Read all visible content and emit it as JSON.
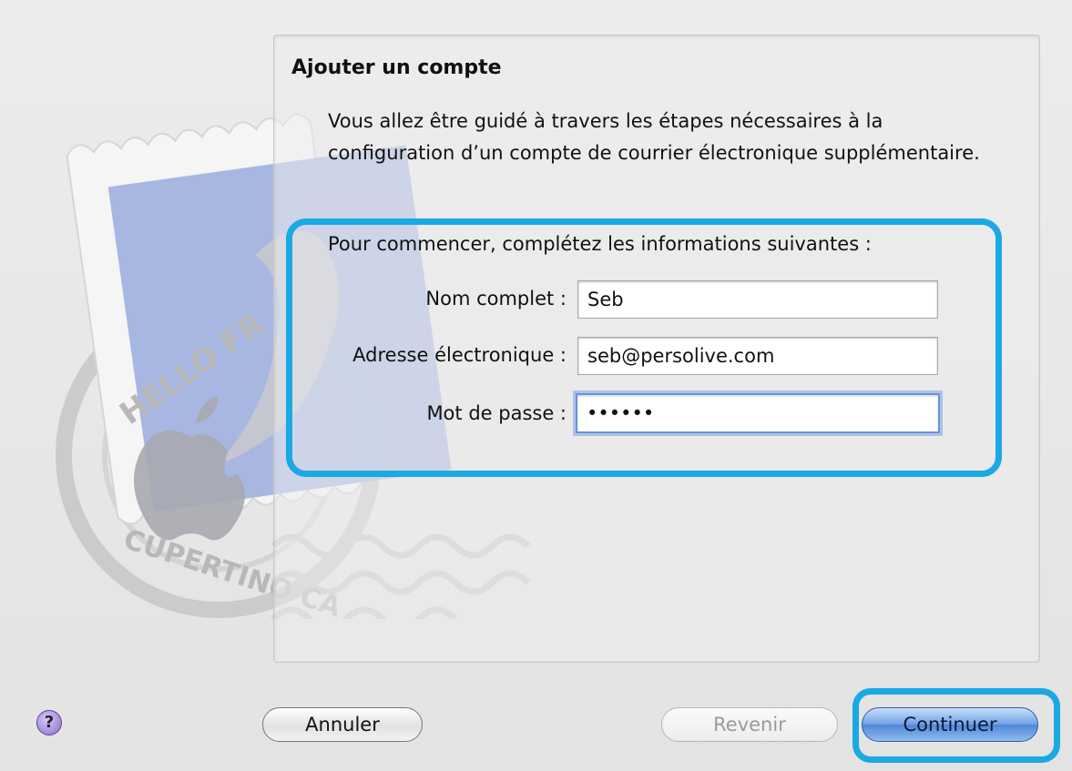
{
  "panel": {
    "title": "Ajouter un compte",
    "intro": "Vous allez être guidé à travers les étapes nécessaires à la configuration d’un compte de courrier électronique supplémentaire.",
    "lead": "Pour commencer, complétez les informations suivantes :"
  },
  "form": {
    "full_name_label": "Nom complet :",
    "full_name_value": "Seb",
    "email_label": "Adresse électronique :",
    "email_value": "seb@persolive.com",
    "password_label": "Mot de passe :",
    "password_value": "••••••"
  },
  "stamp": {
    "top_text": "HELLO FR",
    "bottom_text": "CUPERTINO CA"
  },
  "buttons": {
    "help": "?",
    "cancel": "Annuler",
    "back": "Revenir",
    "continue": "Continuer"
  },
  "colors": {
    "highlight": "#1aa9e3",
    "default_button": "#4f86d7"
  }
}
